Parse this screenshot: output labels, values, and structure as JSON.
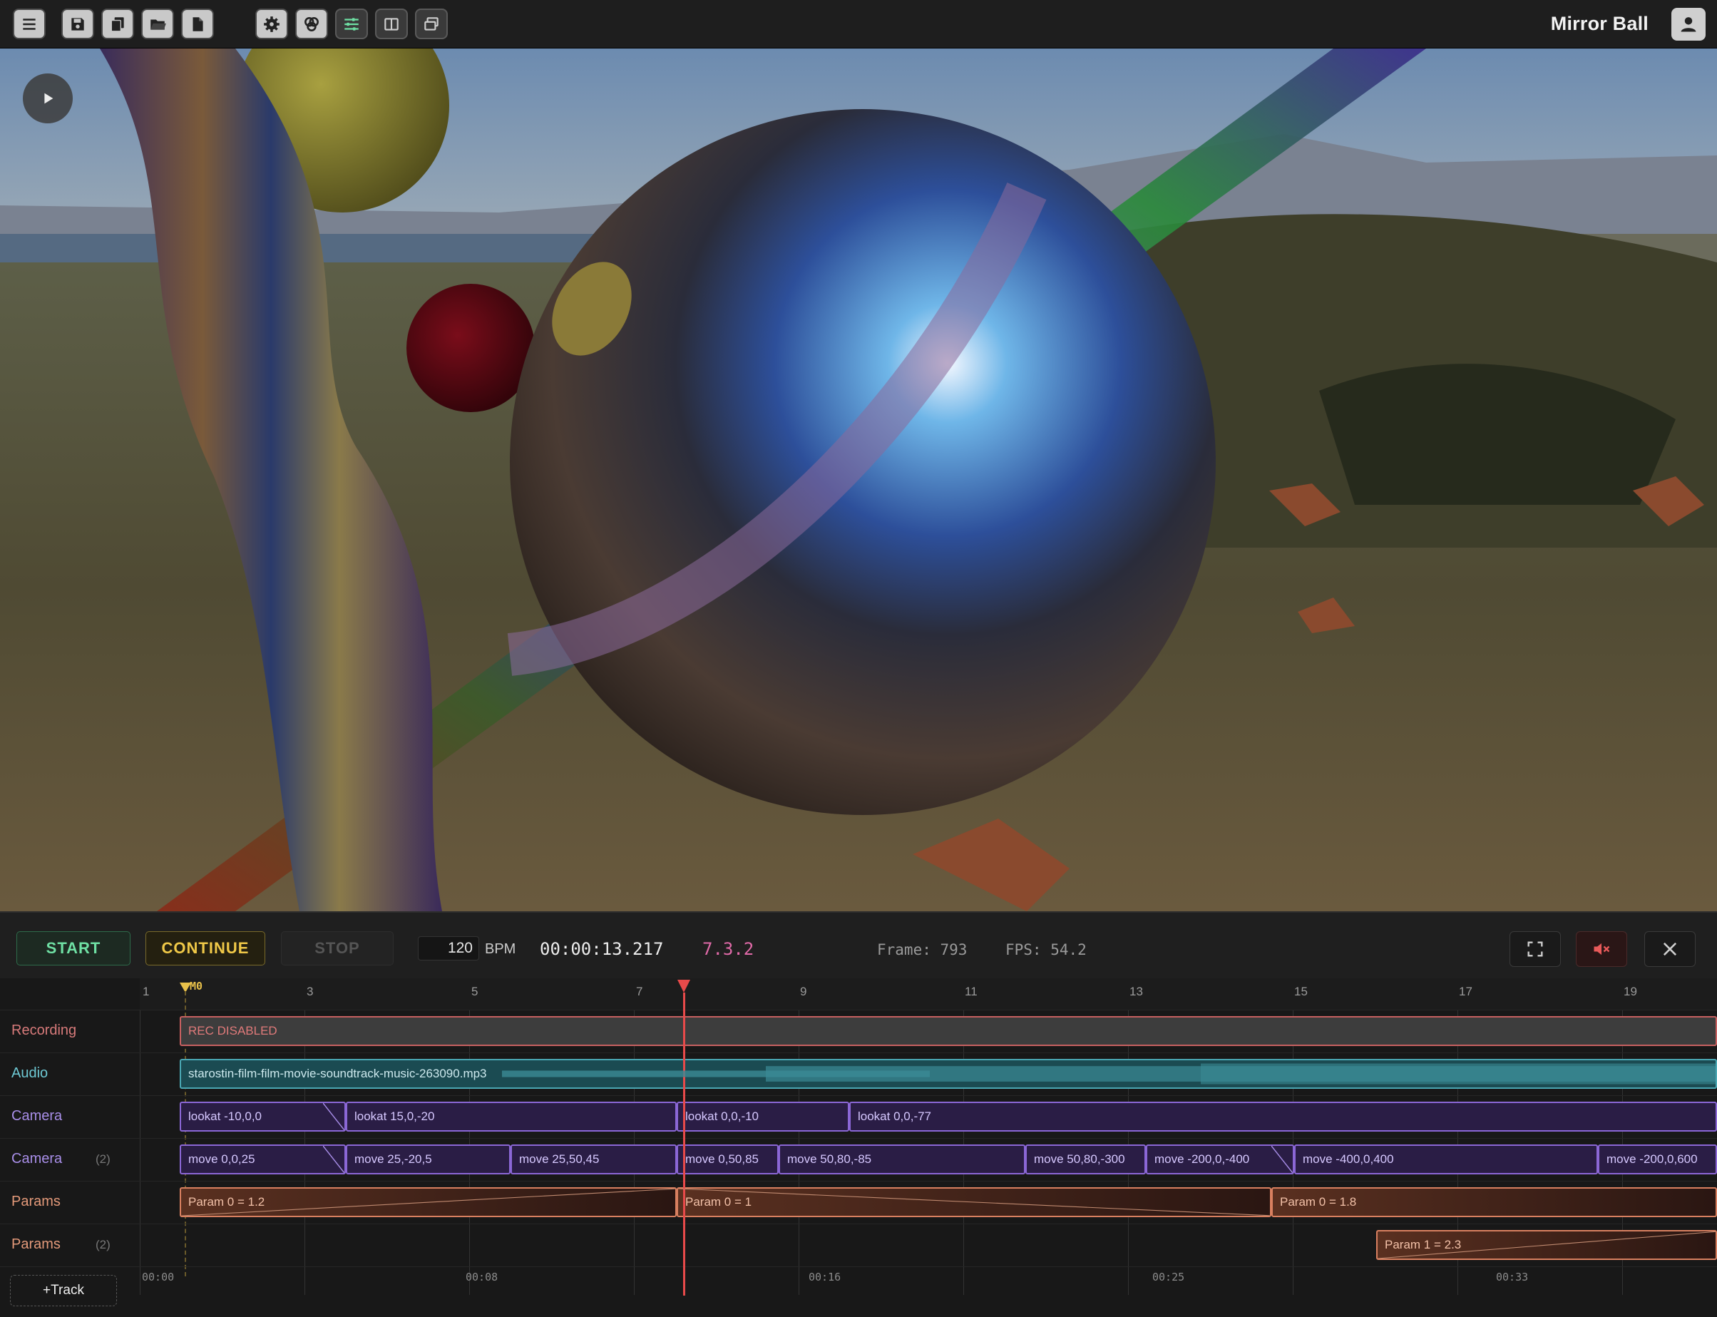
{
  "toolbar": {
    "left_icons": [
      "menu-icon",
      "save-icon",
      "duplicate-icon",
      "folder-open-icon",
      "new-file-icon"
    ],
    "right_icons": [
      "gear-icon",
      "effects-icon",
      "sliders-icon",
      "split-view-icon",
      "windows-icon"
    ],
    "title": "Mirror Ball",
    "user_icon": "user-icon"
  },
  "viewport": {
    "play_icon": "play-icon"
  },
  "transport": {
    "start": "START",
    "continue": "CONTINUE",
    "stop": "STOP",
    "bpm_value": "120",
    "bpm_label": "BPM",
    "clock": "00:00:13.217",
    "position": "7.3.2",
    "frame": "Frame: 793",
    "fps": "FPS: 54.2",
    "right_icons": [
      "fullscreen-icon",
      "mute-icon",
      "close-icon"
    ],
    "colors": {
      "start": "#6fe0a4",
      "continue": "#f0c948",
      "position": "#e06aa8",
      "playhead": "#e84a4a"
    }
  },
  "ruler": {
    "bars": [
      "1",
      "3",
      "5",
      "7",
      "9",
      "11",
      "13",
      "15",
      "17",
      "19"
    ],
    "marker": "M0",
    "times": [
      "00:00",
      "00:08",
      "00:16",
      "00:25",
      "00:33"
    ]
  },
  "tracks": [
    {
      "label": "Recording",
      "count": "",
      "clips": [
        {
          "text": "REC DISABLED"
        }
      ]
    },
    {
      "label": "Audio",
      "count": "",
      "clips": [
        {
          "text": "starostin-film-film-movie-soundtrack-music-263090.mp3"
        }
      ]
    },
    {
      "label": "Camera",
      "count": "",
      "clips": [
        {
          "text": "lookat -10,0,0"
        },
        {
          "text": "lookat 15,0,-20"
        },
        {
          "text": "lookat 0,0,-10"
        },
        {
          "text": "lookat 0,0,-77"
        }
      ]
    },
    {
      "label": "Camera",
      "count": "(2)",
      "clips": [
        {
          "text": "move  0,0,25"
        },
        {
          "text": "move  25,-20,5"
        },
        {
          "text": "move  25,50,45"
        },
        {
          "text": "move  0,50,85"
        },
        {
          "text": "move  50,80,-85"
        },
        {
          "text": "move  50,80,-300"
        },
        {
          "text": "move  -200,0,-400"
        },
        {
          "text": "move  -400,0,400"
        },
        {
          "text": "move  -200,0,600"
        }
      ]
    },
    {
      "label": "Params",
      "count": "",
      "clips": [
        {
          "text": "Param 0 = 1.2"
        },
        {
          "text": "Param 0 = 1"
        },
        {
          "text": "Param 0 = 1.8"
        }
      ]
    },
    {
      "label": "Params",
      "count": "(2)",
      "clips": [
        {
          "text": "Param 1 = 2.3"
        }
      ]
    }
  ],
  "add_track": "+Track"
}
